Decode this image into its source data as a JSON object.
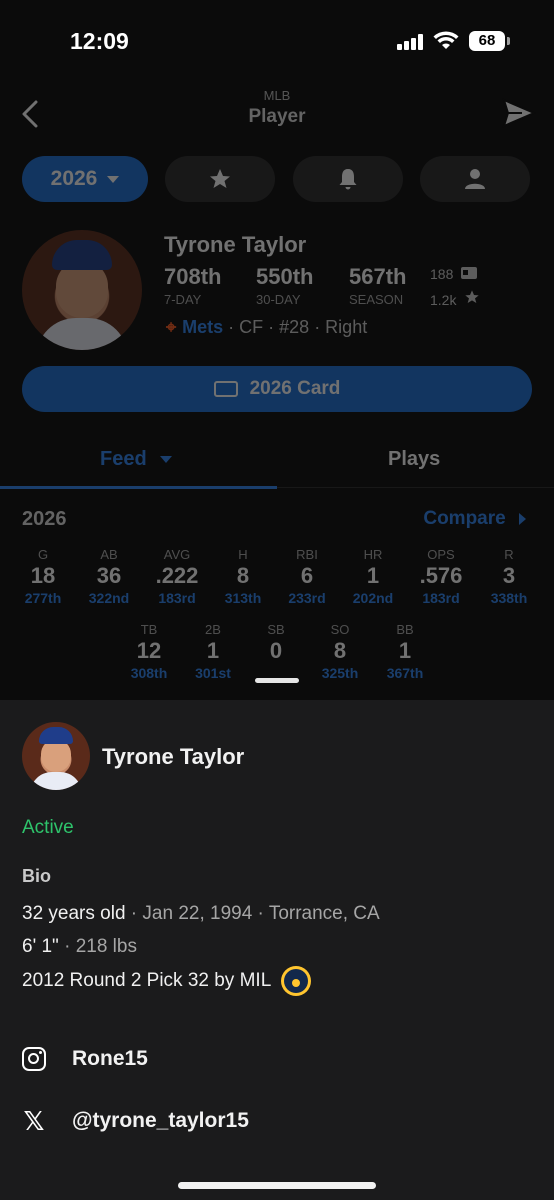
{
  "status": {
    "time": "12:09",
    "battery": "68"
  },
  "nav": {
    "league": "MLB",
    "title": "Player"
  },
  "filters": {
    "year": "2026"
  },
  "player": {
    "name": "Tyrone Taylor",
    "ranks": [
      {
        "value": "708th",
        "label": "7-DAY"
      },
      {
        "value": "550th",
        "label": "30-DAY"
      },
      {
        "value": "567th",
        "label": "SEASON"
      }
    ],
    "cards_count": "188",
    "likes_count": "1.2k",
    "team": "Mets",
    "meta_rest": "· CF · #28 · Right"
  },
  "card_button": "2026 Card",
  "tabs": {
    "feed": "Feed",
    "plays": "Plays"
  },
  "season_stats": {
    "title": "2026",
    "compare": "Compare",
    "row1": [
      {
        "label": "G",
        "value": "18",
        "rank": "277th"
      },
      {
        "label": "AB",
        "value": "36",
        "rank": "322nd"
      },
      {
        "label": "AVG",
        "value": ".222",
        "rank": "183rd"
      },
      {
        "label": "H",
        "value": "8",
        "rank": "313th"
      },
      {
        "label": "RBI",
        "value": "6",
        "rank": "233rd"
      },
      {
        "label": "HR",
        "value": "1",
        "rank": "202nd"
      },
      {
        "label": "OPS",
        "value": ".576",
        "rank": "183rd"
      },
      {
        "label": "R",
        "value": "3",
        "rank": "338th"
      }
    ],
    "row2": [
      {
        "label": "TB",
        "value": "12",
        "rank": "308th"
      },
      {
        "label": "2B",
        "value": "1",
        "rank": "301st"
      },
      {
        "label": "SB",
        "value": "0",
        "rank": ""
      },
      {
        "label": "SO",
        "value": "8",
        "rank": "325th"
      },
      {
        "label": "BB",
        "value": "1",
        "rank": "367th"
      }
    ]
  },
  "sheet": {
    "name": "Tyrone Taylor",
    "status": "Active",
    "bio_heading": "Bio",
    "age": "32 years old",
    "birthdate": "Jan 22, 1994",
    "birthplace": "Torrance, CA",
    "height": "6' 1\"",
    "weight": "218 lbs",
    "draft": "2012 Round 2 Pick 32 by MIL",
    "instagram": "Rone15",
    "x_handle": "@tyrone_taylor15"
  },
  "colors": {
    "accent": "#1d6fd6",
    "link": "#2f86f3",
    "active": "#2ec36b",
    "sheet_bg": "#1b1b1c"
  },
  "icons": [
    "back-chevron-icon",
    "send-icon",
    "star-icon",
    "bell-icon",
    "person-icon",
    "id-card-icon",
    "mets-logo-icon",
    "brewers-logo-icon",
    "instagram-icon",
    "x-logo-icon"
  ]
}
